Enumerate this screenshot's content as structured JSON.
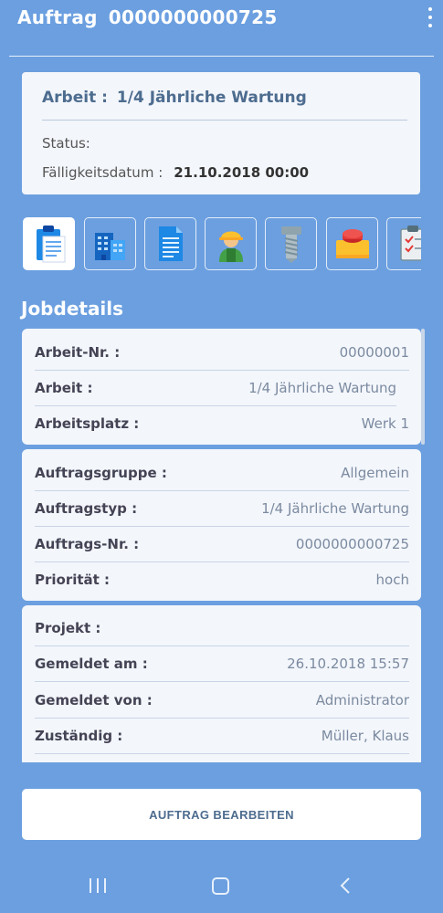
{
  "appbar": {
    "label": "Auftrag",
    "order_number": "0000000000725",
    "menu_icon": "more-vert-icon"
  },
  "summary": {
    "arbeit_label": "Arbeit :",
    "arbeit_value": "1/4 Jährliche Wartung",
    "status_label": "Status:",
    "status_value": "",
    "due_label": "Fälligkeitsdatum :",
    "due_value": "21.10.2018 00:00"
  },
  "icon_tabs": [
    {
      "icon": "clipboard-list-icon",
      "active": true
    },
    {
      "icon": "building-icon",
      "active": false
    },
    {
      "icon": "document-icon",
      "active": false
    },
    {
      "icon": "worker-icon",
      "active": false
    },
    {
      "icon": "screw-icon",
      "active": false
    },
    {
      "icon": "emergency-button-icon",
      "active": false
    },
    {
      "icon": "checklist-icon",
      "active": false
    }
  ],
  "section_title": "Jobdetails",
  "group1": [
    {
      "label": "Arbeit-Nr. :",
      "value": "00000001"
    },
    {
      "label": "Arbeit :",
      "value": "1/4 Jährliche Wartung"
    },
    {
      "label": "Arbeitsplatz :",
      "value": "Werk 1"
    }
  ],
  "group2": [
    {
      "label": "Auftragsgruppe :",
      "value": "Allgemein"
    },
    {
      "label": "Auftragstyp :",
      "value": "1/4 Jährliche Wartung"
    },
    {
      "label": "Auftrags-Nr. :",
      "value": "0000000000725"
    },
    {
      "label": "Priorität :",
      "value": "hoch"
    }
  ],
  "group3": [
    {
      "label": "Projekt :",
      "value": ""
    },
    {
      "label": "Gemeldet am :",
      "value": "26.10.2018 15:57"
    },
    {
      "label": "Gemeldet von :",
      "value": "Administrator"
    },
    {
      "label": "Zuständig :",
      "value": "Müller, Klaus"
    }
  ],
  "edit_button_label": "AUFTRAG BEARBEITEN",
  "navbar": {
    "recent_icon": "recent-apps-icon",
    "home_icon": "home-icon",
    "back_icon": "back-icon"
  },
  "colors": {
    "background": "#6b9fe0",
    "card": "#f3f6fb",
    "title_text": "#4d6c8f"
  }
}
